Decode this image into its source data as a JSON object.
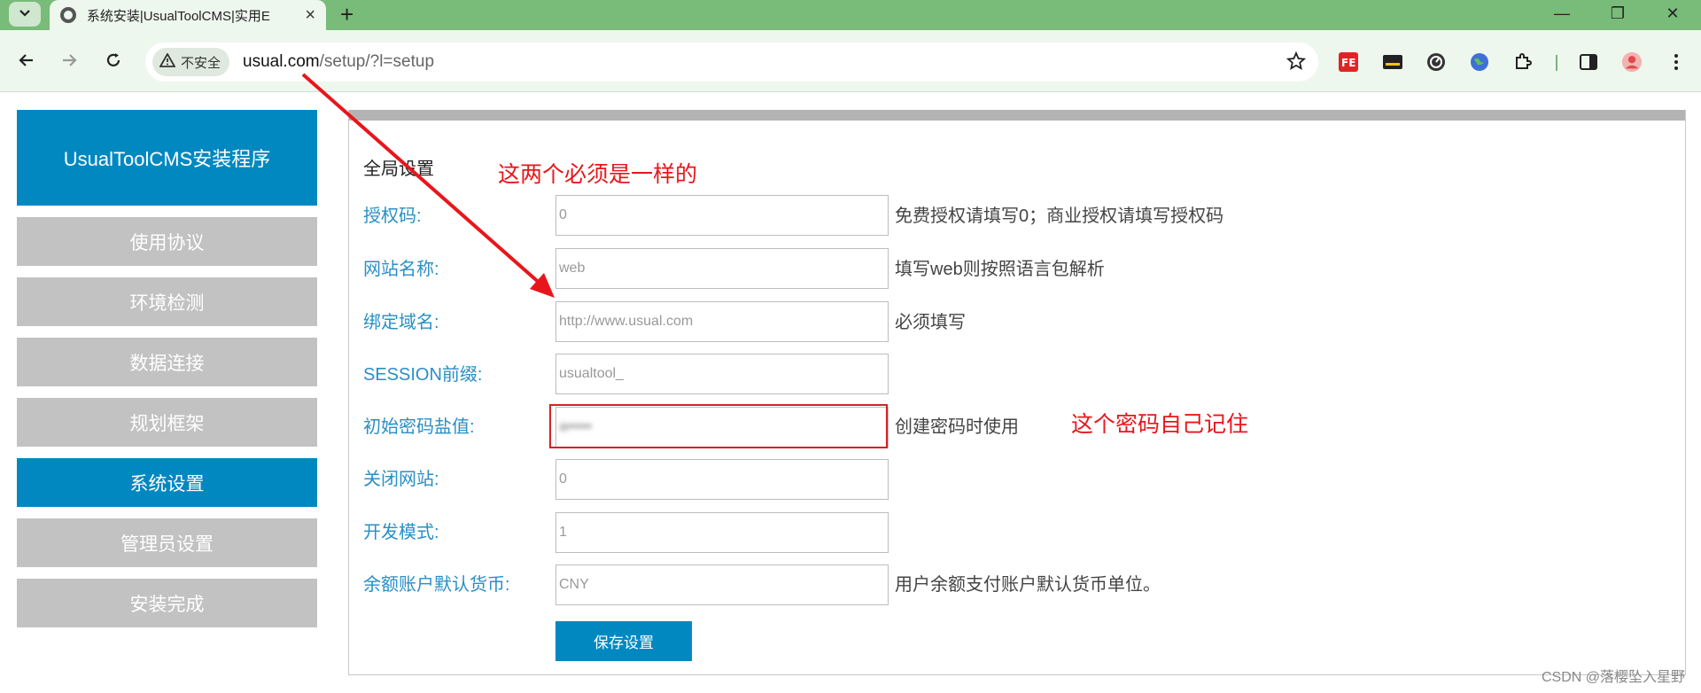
{
  "browser": {
    "tab_title": "系统安装|UsualToolCMS|实用E",
    "new_tab": "+",
    "security_label": "不安全",
    "url_host": "usual.com",
    "url_path": "/setup/?l=setup",
    "window_minimize": "—",
    "window_restore": "❐",
    "window_close": "✕"
  },
  "sidebar": {
    "brand": "UsualToolCMS安装程序",
    "steps": [
      {
        "label": "使用协议"
      },
      {
        "label": "环境检测"
      },
      {
        "label": "数据连接"
      },
      {
        "label": "规划框架"
      },
      {
        "label": "系统设置"
      },
      {
        "label": "管理员设置"
      },
      {
        "label": "安装完成"
      }
    ],
    "active_step": "系统设置"
  },
  "form": {
    "section_title": "全局设置",
    "rows": [
      {
        "label": "授权码:",
        "value": "0",
        "hint": "免费授权请填写0；商业授权请填写授权码"
      },
      {
        "label": "网站名称:",
        "value": "web",
        "hint": "填写web则按照语言包解析"
      },
      {
        "label": "绑定域名:",
        "value": "http://www.usual.com",
        "hint": "必须填写"
      },
      {
        "label": "SESSION前缀:",
        "value": "usualtool_",
        "hint": ""
      },
      {
        "label": "初始密码盐值:",
        "value": "a•••••",
        "hint": "创建密码时使用"
      },
      {
        "label": "关闭网站:",
        "value": "0",
        "hint": ""
      },
      {
        "label": "开发模式:",
        "value": "1",
        "hint": ""
      },
      {
        "label": "余额账户默认货币:",
        "value": "CNY",
        "hint": "用户余额支付账户默认货币单位。"
      }
    ],
    "save_label": "保存设置"
  },
  "annotations": {
    "note_same": "这两个必须是一样的",
    "note_password": "这个密码自己记住",
    "color": "#e8161b"
  },
  "watermark": "CSDN @落樱坠入星野"
}
